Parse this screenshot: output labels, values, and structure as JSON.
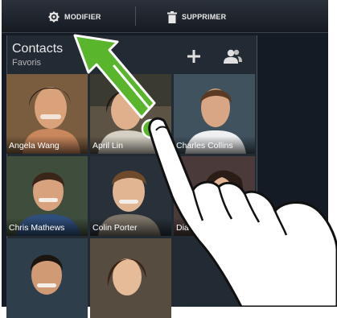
{
  "toolbar": {
    "edit_label": "MODIFIER",
    "delete_label": "SUPPRIMER"
  },
  "header": {
    "title": "Contacts",
    "subtitle": "Favoris"
  },
  "contacts": [
    "Angela Wang",
    "April Lin",
    "Charles Collins",
    "Chris Mathews",
    "Colin Porter",
    "Dia"
  ],
  "colors": {
    "arrow": "#5bb830",
    "background": "#151b24",
    "panel": "#222a33"
  },
  "icons": [
    "gear-icon",
    "trash-icon",
    "plus-icon",
    "add-group-icon",
    "drag-arrow-icon",
    "hand-gesture-icon"
  ]
}
